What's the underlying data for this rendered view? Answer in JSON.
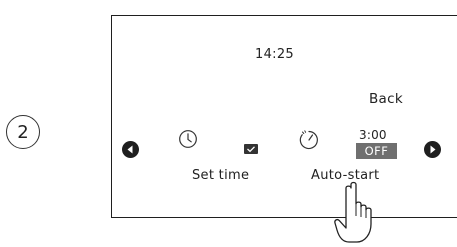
{
  "step": {
    "number": "2"
  },
  "screen": {
    "time": "14:25",
    "back_label": "Back",
    "set_time_label": "Set time",
    "auto_start_label": "Auto-start",
    "auto_start_time": "3:00",
    "auto_start_state": "OFF"
  },
  "icons": {
    "prev": "chevron-left-icon",
    "next": "chevron-right-icon",
    "clock": "clock-icon",
    "confirm": "checkmark-icon",
    "timer": "timer-icon",
    "hand": "pointing-hand-icon"
  },
  "colors": {
    "frame": "#1f1f1f",
    "badge_background": "#6f6f6f",
    "badge_text": "#ffffff"
  }
}
